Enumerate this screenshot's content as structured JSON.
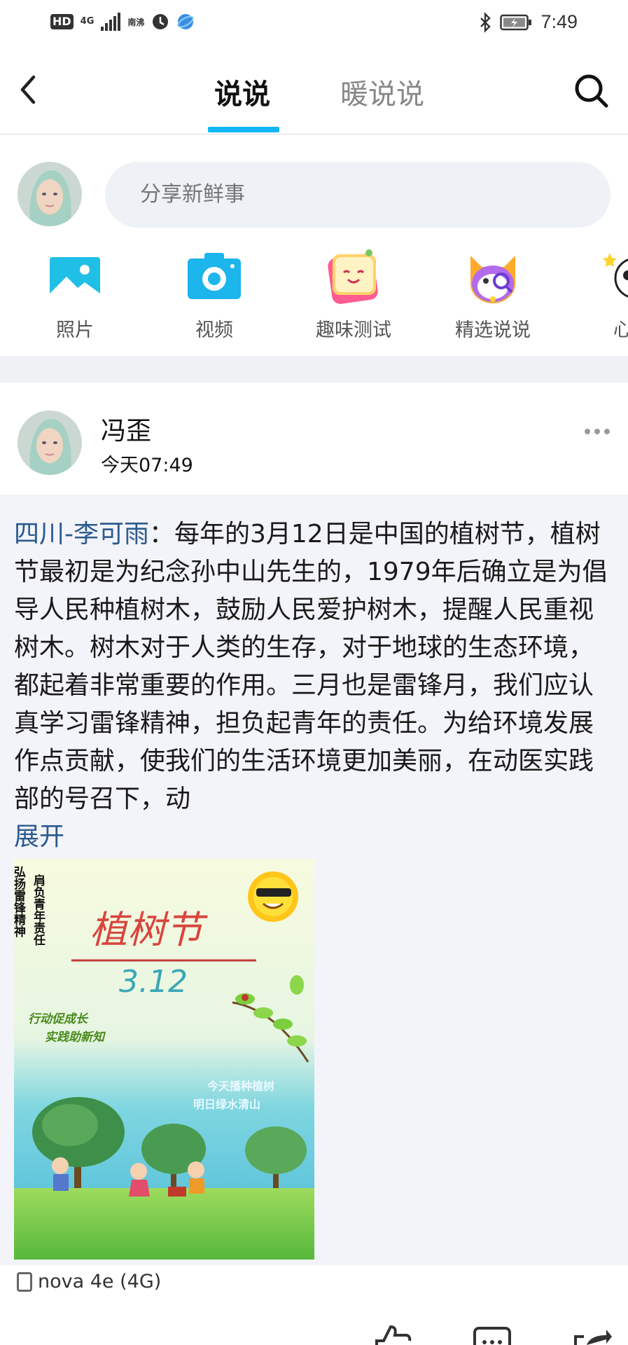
{
  "status_bar": {
    "hd": "HD",
    "network": "4G",
    "carrier_small": "南沸",
    "time": "7:49"
  },
  "nav": {
    "tab_active": "说说",
    "tab_inactive": "暖说说"
  },
  "composer": {
    "placeholder": "分享新鲜事",
    "actions": [
      {
        "label": "照片",
        "icon": "photo-icon"
      },
      {
        "label": "视频",
        "icon": "camera-icon"
      },
      {
        "label": "趣味测试",
        "icon": "quiz-icon"
      },
      {
        "label": "精选说说",
        "icon": "cat-magnifier-icon"
      },
      {
        "label": "心情",
        "icon": "mood-icon"
      }
    ]
  },
  "post": {
    "author": "冯歪",
    "time": "今天07:49",
    "repost_from": "四川-李可雨",
    "text": "：每年的3月12日是中国的植树节，植树节最初是为纪念孙中山先生的，1979年后确立是为倡导人民种植树木，鼓励人民爱护树木，提醒人民重视树木。树木对于人类的生存，对于地球的生态环境，都起着非常重要的作用。三月也是雷锋月，我们应认真学习雷锋精神，担负起青年的责任。为给环境发展作点贡献，使我们的生活环境更加美丽，在动医实践部的号召下，动",
    "expand_label": "展开",
    "poster": {
      "title": "植树节",
      "date": "3.12",
      "vertical_left": "弘扬雷锋精神",
      "vertical_right": "肩负青年责任",
      "slogan1": "行动促成长",
      "slogan2": "实践助新知",
      "slogan3": "今天播种植树",
      "slogan4": "明日绿水清山"
    },
    "device": "nova 4e (4G)"
  },
  "colors": {
    "accent": "#12b7f5",
    "link": "#2b5a8f",
    "body_bg": "#f3f4f9"
  }
}
